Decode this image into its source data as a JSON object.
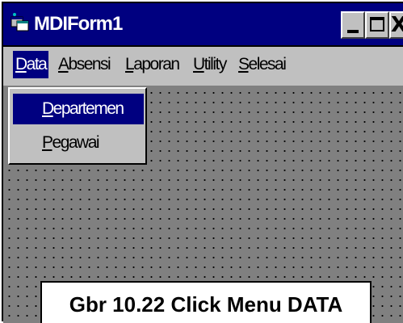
{
  "window": {
    "title": "MDIForm1",
    "title_bar_color": "#000080",
    "icon": "mdi-app-icon",
    "controls": {
      "minimize_icon": "minimize-icon",
      "maximize_icon": "maximize-icon",
      "close_label": "X"
    }
  },
  "menubar": {
    "items": [
      {
        "prefix": "",
        "accel": "D",
        "rest": "ata",
        "active": true
      },
      {
        "prefix": "",
        "accel": "A",
        "rest": "bsensi",
        "active": false
      },
      {
        "prefix": "",
        "accel": "L",
        "rest": "aporan",
        "active": false
      },
      {
        "prefix": "",
        "accel": "U",
        "rest": "tility",
        "active": false
      },
      {
        "prefix": "",
        "accel": "S",
        "rest": "elesai",
        "active": false
      }
    ]
  },
  "dropdown": {
    "items": [
      {
        "accel": "D",
        "rest": "epartemen",
        "highlighted": true
      },
      {
        "accel": "P",
        "rest": "egawai",
        "highlighted": false
      }
    ]
  },
  "caption": {
    "text": "Gbr 10.22 Click Menu DATA"
  },
  "colors": {
    "highlight": "#000080",
    "menu_bg": "#c0c0c0",
    "client_bg": "#808080"
  }
}
